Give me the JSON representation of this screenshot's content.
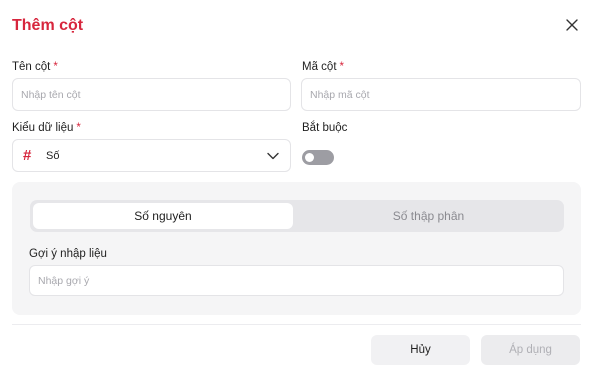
{
  "dialog": {
    "title": "Thêm cột",
    "close_icon": "close-icon"
  },
  "fields": {
    "column_name": {
      "label": "Tên cột",
      "required_mark": "*",
      "placeholder": "Nhập tên cột",
      "value": ""
    },
    "column_code": {
      "label": "Mã cột",
      "required_mark": "*",
      "placeholder": "Nhập mã cột",
      "value": ""
    },
    "data_type": {
      "label": "Kiểu dữ liệu",
      "required_mark": "*",
      "icon_glyph": "#",
      "icon": "hash-icon",
      "value": "Số",
      "chevron_icon": "chevron-down-icon"
    },
    "required": {
      "label": "Bắt buộc",
      "checked": false
    }
  },
  "number_panel": {
    "tabs": [
      {
        "label": "Số nguyên",
        "active": true
      },
      {
        "label": "Số thập phân",
        "active": false
      }
    ],
    "hint": {
      "label": "Gợi ý nhập liệu",
      "placeholder": "Nhập gợi ý",
      "value": ""
    }
  },
  "footer": {
    "cancel_label": "Hủy",
    "apply_label": "Áp dụng"
  },
  "colors": {
    "accent": "#d7263d",
    "toggle_off": "#9d9da3",
    "panel_bg": "#f5f5f6"
  }
}
